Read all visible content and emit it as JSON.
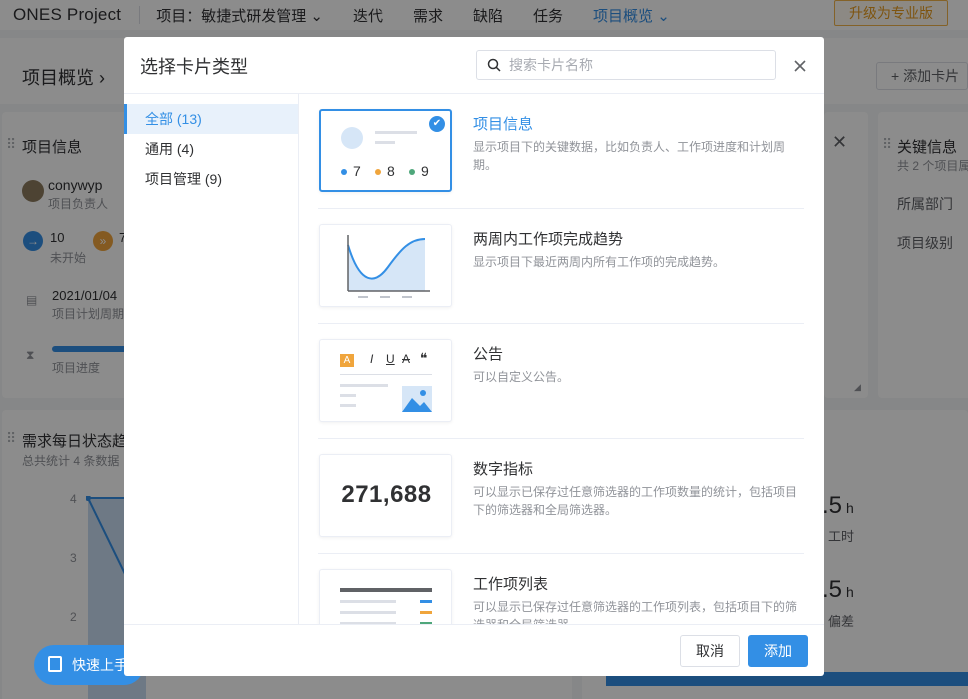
{
  "topbar": {
    "logo": "ONES Project",
    "project": "项目：敏捷式研发管理",
    "nav": [
      "迭代",
      "需求",
      "缺陷",
      "任务"
    ],
    "active_nav": "项目概览",
    "upgrade": "升级为专业版"
  },
  "page": {
    "breadcrumb": "项目概览 ›",
    "add_card": "添加卡片",
    "info_card": {
      "title": "项目信息",
      "user": "conywyp",
      "role": "项目负责人",
      "stat1_value": "10",
      "stat1_label": "未开始",
      "stat2_value": "7",
      "date": "2021/01/04",
      "date_label": "项目计划周期",
      "progress_label": "项目进度"
    },
    "chart_card": {
      "title": "需求每日状态趋",
      "subtitle": "总共统计 4 条数据",
      "ticks": [
        "4",
        "3",
        "2"
      ]
    },
    "key_card": {
      "title": "关键信息",
      "subtitle": "共 2 个项目属",
      "field1": "所属部门",
      "field2": "项目级别"
    },
    "hours": {
      "value1": ".5",
      "unit": "h",
      "label1": "工时",
      "value2": ".5",
      "label2": "偏差"
    },
    "quick_start": "快速上手"
  },
  "modal": {
    "title": "选择卡片类型",
    "search_placeholder": "搜索卡片名称",
    "categories": [
      {
        "label": "全部 (13)",
        "active": true
      },
      {
        "label": "通用 (4)",
        "active": false
      },
      {
        "label": "项目管理 (9)",
        "active": false
      }
    ],
    "cards": [
      {
        "title": "项目信息",
        "desc": "显示项目下的关键数据，比如负责人、工作项进度和计划周期。",
        "selected": true,
        "thumb_values": [
          "7",
          "8",
          "9"
        ]
      },
      {
        "title": "两周内工作项完成趋势",
        "desc": "显示项目下最近两周内所有工作项的完成趋势。",
        "selected": false
      },
      {
        "title": "公告",
        "desc": "可以自定义公告。",
        "selected": false
      },
      {
        "title": "数字指标",
        "desc": "可以显示已保存过任意筛选器的工作项数量的统计，包括项目下的筛选器和全局筛选器。",
        "selected": false,
        "thumb_number": "271,688"
      },
      {
        "title": "工作项列表",
        "desc": "可以显示已保存过任意筛选器的工作项列表，包括项目下的筛选器和全局筛选器。",
        "selected": false
      }
    ],
    "cancel": "取消",
    "add": "添加"
  },
  "colors": {
    "accent": "#338fe5",
    "upgrade": "#e69a1c"
  }
}
